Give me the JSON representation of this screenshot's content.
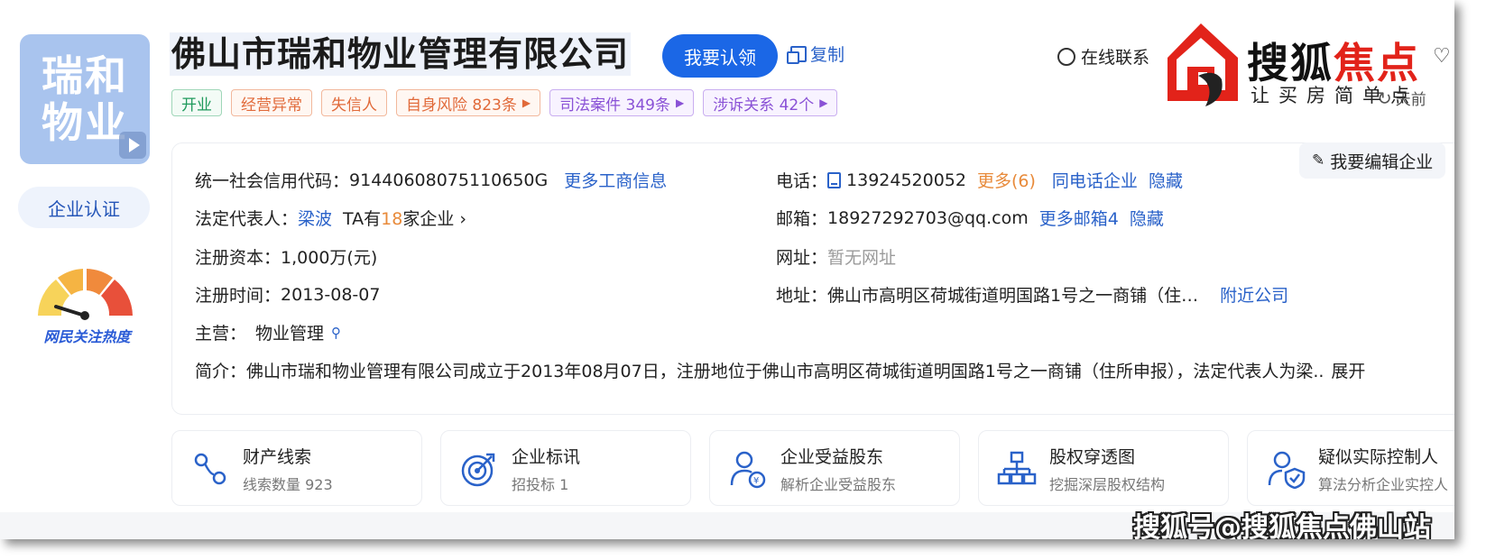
{
  "company": {
    "logo_line1": "瑞和",
    "logo_line2": "物业",
    "name": "佛山市瑞和物业管理有限公司",
    "claim_button": "我要认领",
    "copy_link": "复制",
    "cert_button": "企业认证",
    "heat_label": "网民关注热度"
  },
  "header_actions": {
    "online_contact": "在线联系",
    "refresh_text": "天前"
  },
  "watermark": {
    "brand_main": "搜狐",
    "brand_accent": "焦点",
    "brand_tagline": "让买房简单点",
    "bottom_text": "搜狐号@搜狐焦点佛山站"
  },
  "tags": [
    {
      "label": "开业",
      "style": "green"
    },
    {
      "label": "经营异常",
      "style": "orange"
    },
    {
      "label": "失信人",
      "style": "orange"
    },
    {
      "label": "自身风险 823条",
      "style": "orange",
      "arrow": true
    },
    {
      "label": "司法案件 349条",
      "style": "purple",
      "arrow": true
    },
    {
      "label": "涉诉关系 42个",
      "style": "purple",
      "arrow": true
    }
  ],
  "info": {
    "edit_button": "我要编辑企业",
    "credit_code_label": "统一社会信用代码：",
    "credit_code_value": "91440608075110650G",
    "more_business_info": "更多工商信息",
    "legal_rep_label": "法定代表人：",
    "legal_rep_name": "梁波",
    "legal_rep_ta_prefix": "TA有",
    "legal_rep_count": "18",
    "legal_rep_ta_suffix": "家企业",
    "reg_capital_label": "注册资本：",
    "reg_capital_value": "1,000万(元)",
    "reg_time_label": "注册时间：",
    "reg_time_value": "2013-08-07",
    "main_business_label": "主营：",
    "main_business_value": "物业管理",
    "phone_label": "电话：",
    "phone_value": "13924520052",
    "phone_more": "更多(6)",
    "phone_same": "同电话企业",
    "phone_hide": "隐藏",
    "email_label": "邮箱：",
    "email_value": "18927292703@qq.com",
    "email_more": "更多邮箱4",
    "email_hide": "隐藏",
    "website_label": "网址：",
    "website_value": "暂无网址",
    "address_label": "地址：",
    "address_value": "佛山市高明区荷城街道明国路1号之一商铺（住…",
    "address_nearby": "附近公司",
    "intro_label": "简介：",
    "intro_value": "佛山市瑞和物业管理有限公司成立于2013年08月07日，注册地位于佛山市高明区荷城街道明国路1号之一商铺（住所申报），法定代表人为梁..",
    "intro_expand": "展开"
  },
  "features": [
    {
      "title": "财产线索",
      "sub": "线索数量 923",
      "icon": "asset-clue-icon"
    },
    {
      "title": "企业标讯",
      "sub": "招投标 1",
      "icon": "bid-target-icon"
    },
    {
      "title": "企业受益股东",
      "sub": "解析企业受益股东",
      "icon": "beneficiary-icon"
    },
    {
      "title": "股权穿透图",
      "sub": "挖掘深层股权结构",
      "icon": "equity-tree-icon"
    },
    {
      "title": "疑似实际控制人",
      "sub": "算法分析企业实控人",
      "icon": "controller-shield-icon"
    }
  ],
  "colors": {
    "primary": "#1b67e6",
    "link": "#2a62c9",
    "accent_red": "#e2231a"
  }
}
